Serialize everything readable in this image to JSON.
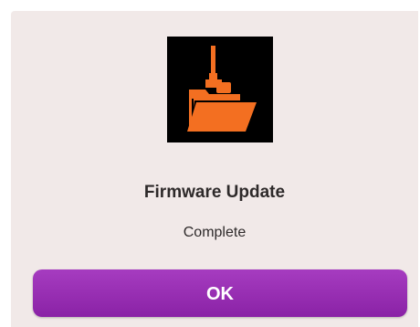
{
  "dialog": {
    "icon": "firmware-folder-icon",
    "title": "Firmware Update",
    "message": "Complete",
    "ok_label": "OK"
  },
  "colors": {
    "dialog_background": "#f1e9e8",
    "icon_background": "#000000",
    "icon_accent": "#f36f21",
    "button_background": "#9830b4",
    "button_text": "#ffffff"
  }
}
